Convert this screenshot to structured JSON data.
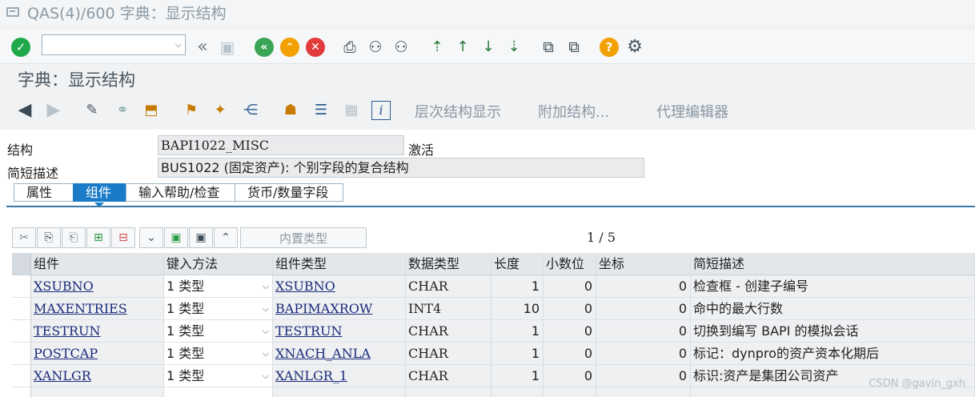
{
  "window": {
    "title": "QAS(4)/600 字典：显示结构"
  },
  "screen": {
    "title": "字典：显示结构"
  },
  "app_toolbar": {
    "hierarchy_label": "层次结构显示",
    "append_label": "附加结构...",
    "proxy_label": "代理编辑器"
  },
  "header_fields": {
    "structure_label": "结构",
    "structure_value": "BAPI1022_MISC",
    "status": "激活",
    "short_desc_label": "简短描述",
    "short_desc_value": "BUS1022 (固定资产): 个别字段的复合结构"
  },
  "tabs": [
    {
      "label": "属性",
      "active": false
    },
    {
      "label": "组件",
      "active": true
    },
    {
      "label": "输入帮助/检查",
      "active": false
    },
    {
      "label": "货币/数量字段",
      "active": false
    }
  ],
  "table_toolbar": {
    "builtin_type_label": "内置类型",
    "pager": "1 / 5"
  },
  "grid": {
    "columns": [
      "组件",
      "键入方法",
      "组件类型",
      "数据类型",
      "长度",
      "小数位",
      "坐标",
      "简短描述"
    ],
    "rows": [
      {
        "component": "XSUBNO",
        "entry": "1 类型",
        "comp_type": "XSUBNO",
        "data_type": "CHAR",
        "length": "1",
        "decimals": "0",
        "coord": "0",
        "desc": "检查框 - 创建子编号"
      },
      {
        "component": "MAXENTRIES",
        "entry": "1 类型",
        "comp_type": "BAPIMAXROW",
        "data_type": "INT4",
        "length": "10",
        "decimals": "0",
        "coord": "0",
        "desc": "命中的最大行数"
      },
      {
        "component": "TESTRUN",
        "entry": "1 类型",
        "comp_type": "TESTRUN",
        "data_type": "CHAR",
        "length": "1",
        "decimals": "0",
        "coord": "0",
        "desc": "切换到编写 BAPI 的模拟会话"
      },
      {
        "component": "POSTCAP",
        "entry": "1 类型",
        "comp_type": "XNACH_ANLA",
        "data_type": "CHAR",
        "length": "1",
        "decimals": "0",
        "coord": "0",
        "desc": "标记：dynpro的资产资本化期后"
      },
      {
        "component": "XANLGR",
        "entry": "1 类型",
        "comp_type": "XANLGR_1",
        "data_type": "CHAR",
        "length": "1",
        "decimals": "0",
        "coord": "0",
        "desc": "标识:资产是集团公司资产"
      }
    ]
  },
  "watermark": "CSDN @gavin_gxh",
  "icons": {
    "check": "check-icon",
    "back": "back-double-icon",
    "save": "save-icon",
    "nav_back": "nav-back-icon",
    "nav_exit": "nav-exit-icon",
    "cancel": "cancel-icon",
    "print": "print-icon",
    "find": "find-icon",
    "find_next": "find-next-icon",
    "first_page": "first-page-icon",
    "prev_page": "previous-page-icon",
    "next_page": "next-page-icon",
    "last_page": "last-page-icon",
    "new_session": "new-session-icon",
    "shortcut": "shortcut-icon",
    "help": "help-icon",
    "settings": "gear-icon"
  },
  "colors": {
    "accent": "#1a7cc9",
    "ok": "#1fa84a",
    "cancel": "#e23b3b",
    "help": "#f2a100",
    "nav": "#3aa655"
  }
}
